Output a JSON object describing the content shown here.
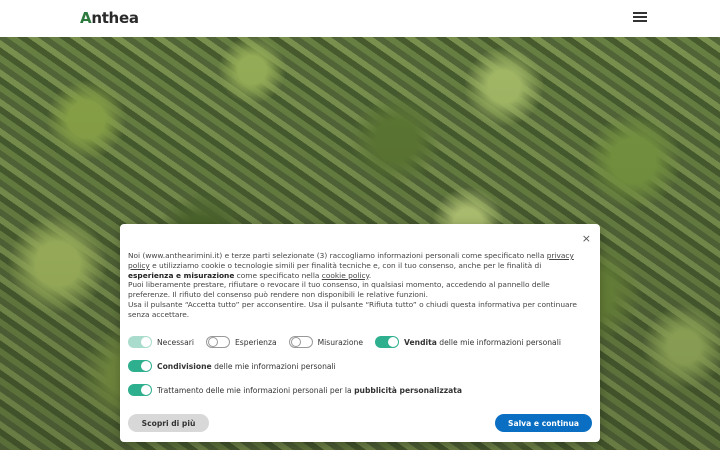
{
  "header": {
    "logo_first": "A",
    "logo_rest": "nthea"
  },
  "dialog": {
    "close_glyph": "×",
    "text": {
      "p1_a": "Noi (www.anthearimini.it) e terze parti selezionate (3) raccogliamo informazioni personali come specificato nella ",
      "privacy_link": "privacy policy",
      "p1_b": " e utilizziamo cookie o tecnologie simili per finalità tecniche e, con il tuo consenso, anche per le finalità di ",
      "p1_bold": "esperienza e misurazione",
      "p1_c": " come specificato nella ",
      "cookie_link": "cookie policy",
      "p1_end": ".",
      "p2": "Puoi liberamente prestare, rifiutare o revocare il tuo consenso, in qualsiasi momento, accedendo al pannello delle preferenze. Il rifiuto del consenso può rendere non disponibili le relative funzioni.",
      "p3": "Usa il pulsante “Accetta tutto” per acconsentire. Usa il pulsante “Rifiuta tutto” o chiudi questa informativa per continuare senza accettare."
    },
    "toggles": {
      "necessari": "Necessari",
      "esperienza": "Esperienza",
      "misurazione": "Misurazione",
      "vendita_bold": "Vendita",
      "vendita_rest": " delle mie informazioni personali",
      "condivisione_bold": "Condivisione",
      "condivisione_rest": " delle mie informazioni personali",
      "trattamento_rest": "Trattamento delle mie informazioni personali per la ",
      "trattamento_bold": "pubblicità personalizzata"
    },
    "toggle_states": {
      "necessari": "on-disabled",
      "esperienza": "off",
      "misurazione": "off",
      "vendita": "on",
      "condivisione": "on",
      "trattamento": "on"
    },
    "buttons": {
      "more": "Scopri di più",
      "save": "Salva e continua"
    }
  },
  "colors": {
    "accent_green": "#2eaf8e",
    "primary_blue": "#0a6fc2",
    "logo_green": "#2c7a3e"
  }
}
